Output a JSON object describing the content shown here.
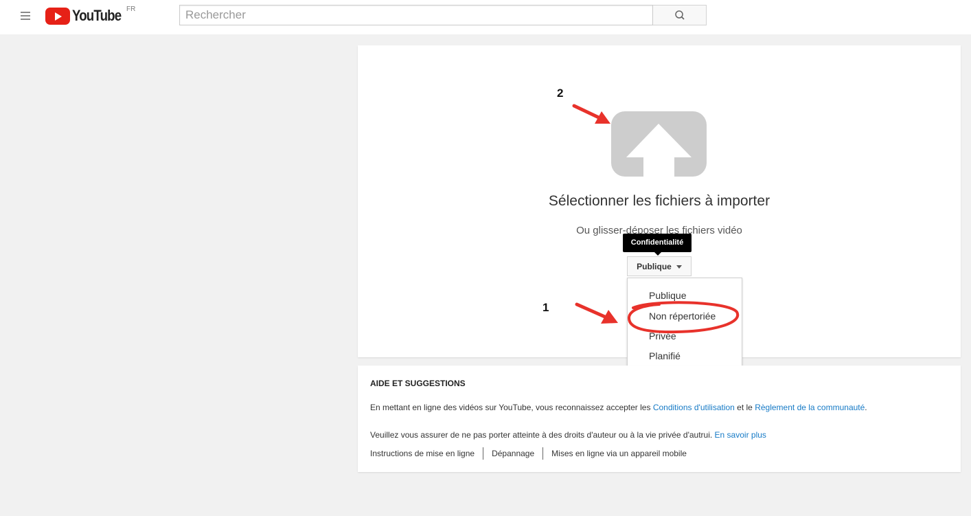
{
  "header": {
    "logo_text": "YouTube",
    "logo_country": "FR",
    "search_placeholder": "Rechercher"
  },
  "upload": {
    "title": "Sélectionner les fichiers à importer",
    "subtitle": "Ou glisser-déposer les fichiers vidéo",
    "tooltip": "Confidentialité",
    "privacy_selected": "Publique",
    "privacy_options": [
      "Publique",
      "Non répertoriée",
      "Privée",
      "Planifié"
    ]
  },
  "help": {
    "title": "AIDE ET SUGGESTIONS",
    "line1_prefix": "En mettant en ligne des vidéos sur YouTube, vous reconnaissez accepter les ",
    "terms_link": "Conditions d'utilisation",
    "line1_mid": " et le ",
    "guidelines_link": "Règlement de la communauté",
    "line1_suffix": ".",
    "line2_prefix": "Veuillez vous assurer de ne pas porter atteinte à des droits d'auteur ou à la vie privée d'autrui. ",
    "learn_more_link": "En savoir plus",
    "links": [
      "Instructions de mise en ligne",
      "Dépannage",
      "Mises en ligne via un appareil mobile"
    ]
  },
  "annotations": {
    "label_1": "1",
    "label_2": "2",
    "color": "#e8322b"
  },
  "colors": {
    "brand_red": "#e62117",
    "link_blue": "#167ac6",
    "page_bg": "#f1f1f1"
  },
  "icons": [
    "menu-icon",
    "youtube-logo-icon",
    "search-icon",
    "upload-arrow-icon",
    "caret-down-icon"
  ]
}
